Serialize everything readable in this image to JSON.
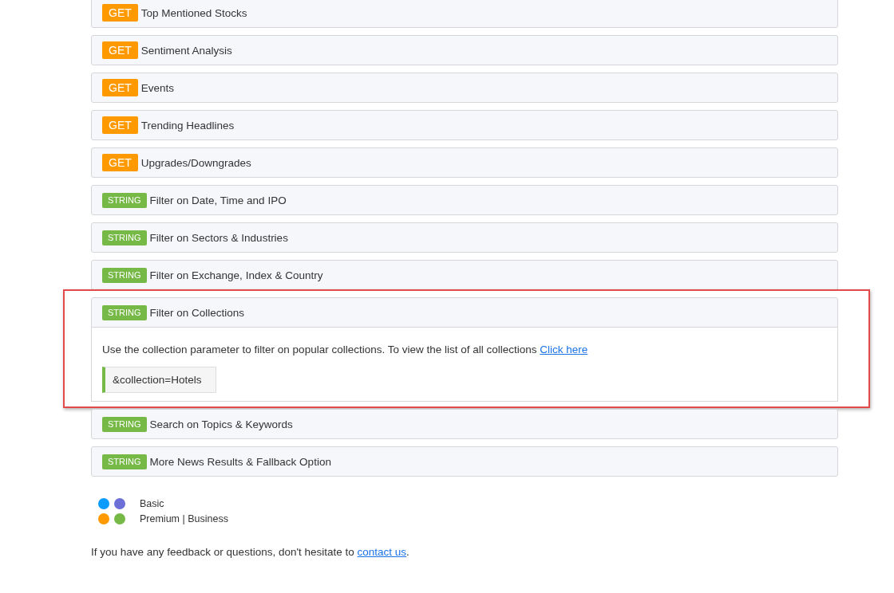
{
  "endpoints": [
    {
      "method": "GET",
      "kind": "get",
      "title": "Top Mentioned Stocks",
      "expanded": false
    },
    {
      "method": "GET",
      "kind": "get",
      "title": "Sentiment Analysis",
      "expanded": false
    },
    {
      "method": "GET",
      "kind": "get",
      "title": "Events",
      "expanded": false
    },
    {
      "method": "GET",
      "kind": "get",
      "title": "Trending Headlines",
      "expanded": false
    },
    {
      "method": "GET",
      "kind": "get",
      "title": "Upgrades/Downgrades",
      "expanded": false
    },
    {
      "method": "STRING",
      "kind": "string",
      "title": "Filter on Date, Time and IPO",
      "expanded": false
    },
    {
      "method": "STRING",
      "kind": "string",
      "title": "Filter on Sectors & Industries",
      "expanded": false
    },
    {
      "method": "STRING",
      "kind": "string",
      "title": "Filter on Exchange, Index & Country",
      "expanded": false
    },
    {
      "method": "STRING",
      "kind": "string",
      "title": "Filter on Collections",
      "expanded": true,
      "highlighted": true,
      "description": "Use the collection parameter to filter on popular collections. To view the list of all collections",
      "link": "Click here",
      "code": "&collection=Hotels"
    },
    {
      "method": "STRING",
      "kind": "string",
      "title": "Search on Topics & Keywords",
      "expanded": false
    },
    {
      "method": "STRING",
      "kind": "string",
      "title": "More News Results & Fallback Option",
      "expanded": false
    }
  ],
  "legend": [
    {
      "label": "Basic",
      "dots": [
        {
          "color": "#0a9bff"
        },
        {
          "color": "#6c6fd6"
        }
      ]
    },
    {
      "label": "Premium | Business",
      "dots": [
        {
          "color": "#ff9900"
        },
        {
          "color": "#76b947"
        }
      ]
    }
  ],
  "footer": {
    "text": "If you have any feedback or questions, don't hesitate to",
    "link": "contact us",
    "end": "."
  }
}
